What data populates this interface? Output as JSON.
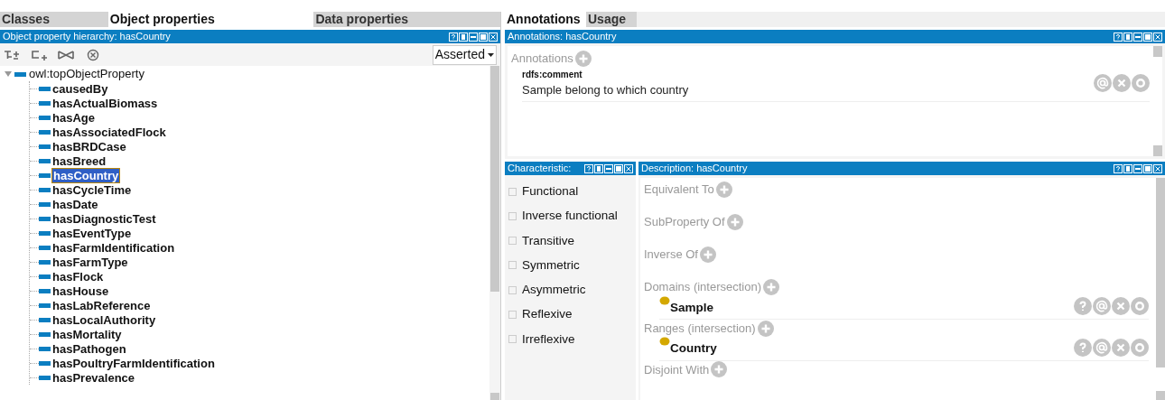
{
  "left_tabs": [
    {
      "label": "Classes",
      "selected": false
    },
    {
      "label": "Object properties",
      "selected": true
    },
    {
      "label": "Data properties",
      "selected": false
    }
  ],
  "hierarchy": {
    "title": "Object property hierarchy: hasCountry",
    "view_mode": "Asserted",
    "tree": {
      "label": "owl:topObjectProperty",
      "expanded": true,
      "children": [
        {
          "label": "causedBy",
          "selected": false
        },
        {
          "label": "hasActualBiomass",
          "selected": false
        },
        {
          "label": "hasAge",
          "selected": false
        },
        {
          "label": "hasAssociatedFlock",
          "selected": false
        },
        {
          "label": "hasBRDCase",
          "selected": false
        },
        {
          "label": "hasBreed",
          "selected": false
        },
        {
          "label": "hasCountry",
          "selected": true
        },
        {
          "label": "hasCycleTime",
          "selected": false
        },
        {
          "label": "hasDate",
          "selected": false
        },
        {
          "label": "hasDiagnosticTest",
          "selected": false
        },
        {
          "label": "hasEventType",
          "selected": false
        },
        {
          "label": "hasFarmIdentification",
          "selected": false
        },
        {
          "label": "hasFarmType",
          "selected": false
        },
        {
          "label": "hasFlock",
          "selected": false
        },
        {
          "label": "hasHouse",
          "selected": false
        },
        {
          "label": "hasLabReference",
          "selected": false
        },
        {
          "label": "hasLocalAuthority",
          "selected": false
        },
        {
          "label": "hasMortality",
          "selected": false
        },
        {
          "label": "hasPathogen",
          "selected": false
        },
        {
          "label": "hasPoultryFarmIdentification",
          "selected": false
        },
        {
          "label": "hasPrevalence",
          "selected": false
        }
      ]
    }
  },
  "right_tabs": [
    {
      "label": "Annotations",
      "selected": true
    },
    {
      "label": "Usage",
      "selected": false
    }
  ],
  "annotations": {
    "title": "Annotations: hasCountry",
    "section": "Annotations",
    "items": [
      {
        "property": "rdfs:comment",
        "value": "Sample belong to which country"
      }
    ]
  },
  "characteristics": {
    "title": "Characteristic:",
    "items": [
      {
        "label": "Functional",
        "checked": false
      },
      {
        "label": "Inverse functional",
        "checked": false
      },
      {
        "label": "Transitive",
        "checked": false
      },
      {
        "label": "Symmetric",
        "checked": false
      },
      {
        "label": "Asymmetric",
        "checked": false
      },
      {
        "label": "Reflexive",
        "checked": false
      },
      {
        "label": "Irreflexive",
        "checked": false
      }
    ]
  },
  "description": {
    "title": "Description: hasCountry",
    "sections": [
      {
        "label": "Equivalent To"
      },
      {
        "label": "SubProperty Of"
      },
      {
        "label": "Inverse Of"
      },
      {
        "label": "Domains (intersection)",
        "items": [
          {
            "label": "Sample"
          }
        ]
      },
      {
        "label": "Ranges (intersection)",
        "items": [
          {
            "label": "Country"
          }
        ]
      },
      {
        "label": "Disjoint With"
      }
    ]
  }
}
